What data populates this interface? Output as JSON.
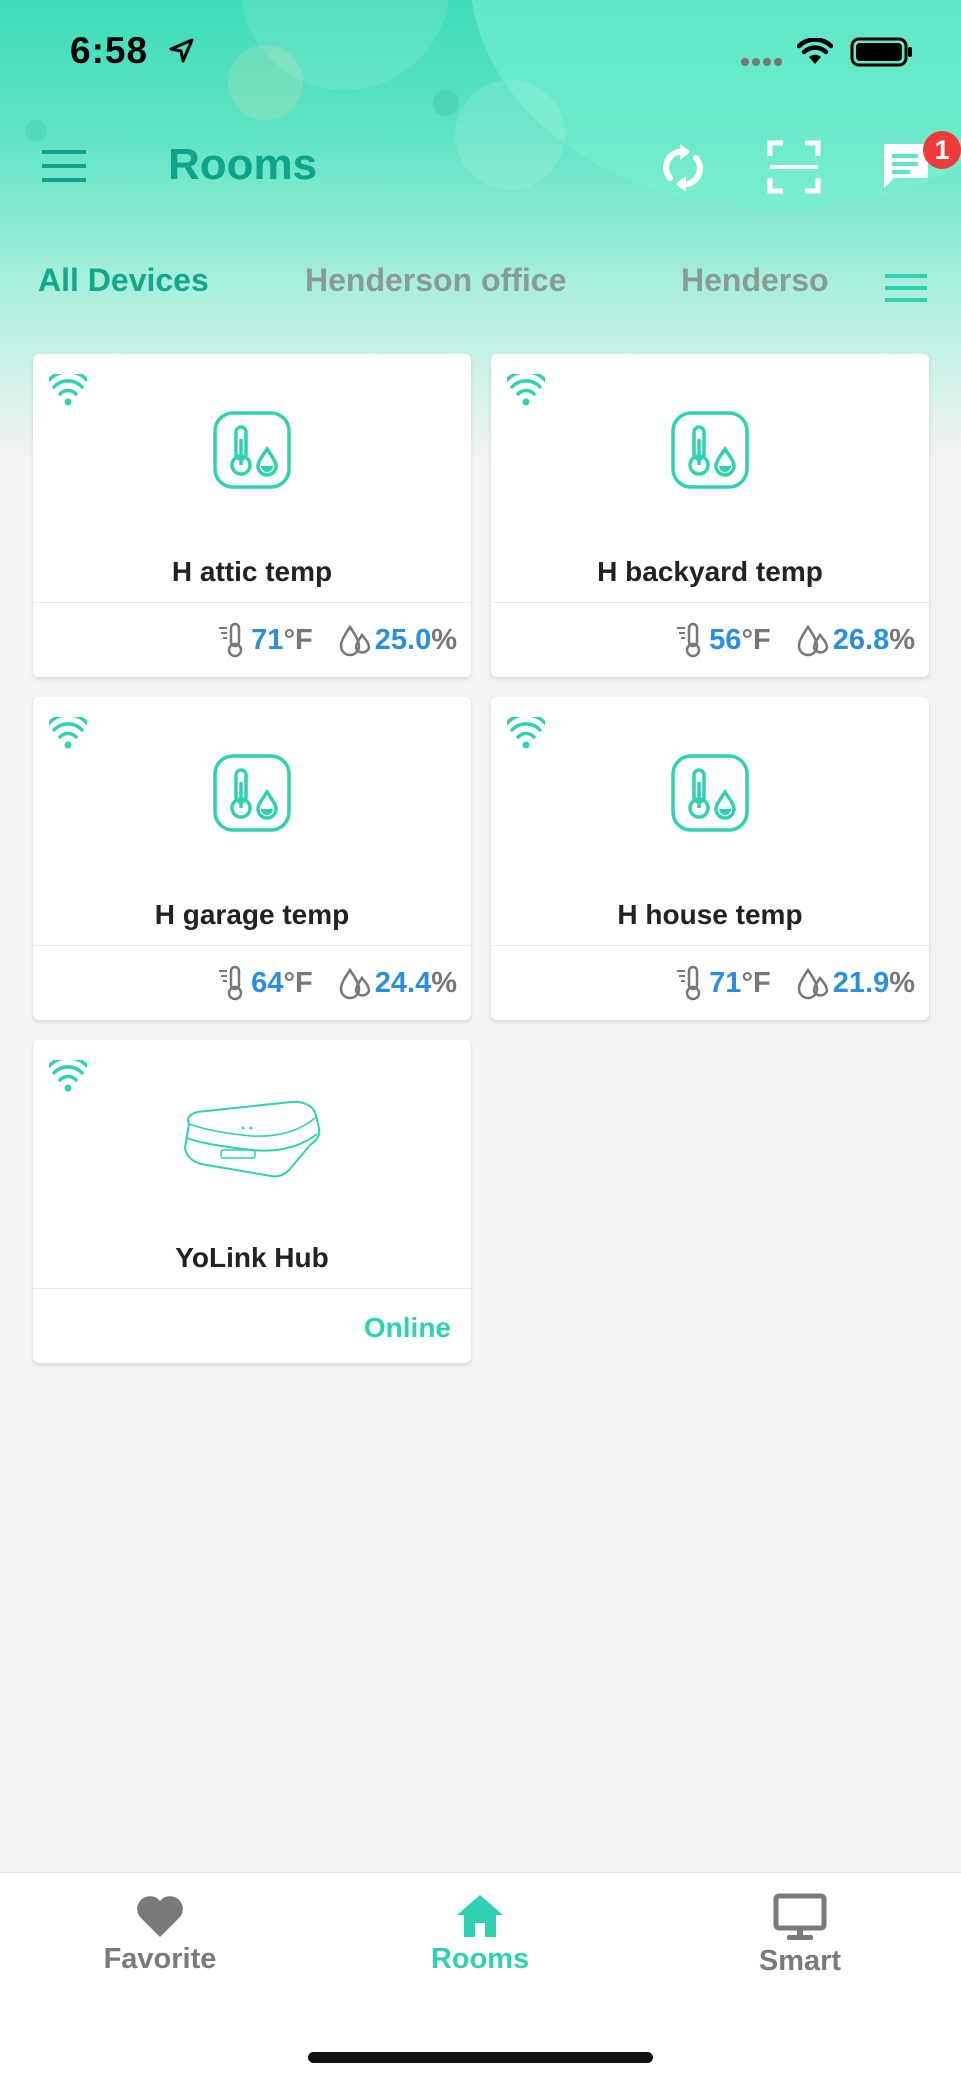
{
  "status_bar": {
    "time": "6:58"
  },
  "header": {
    "title": "Rooms",
    "badge_count": "1"
  },
  "tabs": [
    {
      "label": "All Devices",
      "active": true
    },
    {
      "label": "Henderson office",
      "active": false
    },
    {
      "label": "Henderso",
      "active": false
    }
  ],
  "devices": [
    {
      "name": "H attic temp",
      "temp": "71",
      "temp_unit": "°F",
      "humidity": "25.0",
      "humidity_unit": "%"
    },
    {
      "name": "H backyard temp",
      "temp": "56",
      "temp_unit": "°F",
      "humidity": "26.8",
      "humidity_unit": "%"
    },
    {
      "name": "H garage temp",
      "temp": "64",
      "temp_unit": "°F",
      "humidity": "24.4",
      "humidity_unit": "%"
    },
    {
      "name": "H house temp",
      "temp": "71",
      "temp_unit": "°F",
      "humidity": "21.9",
      "humidity_unit": "%"
    }
  ],
  "hub": {
    "name": "YoLink Hub",
    "status": "Online"
  },
  "bottom_nav": [
    {
      "label": "Favorite",
      "icon": "heart-icon",
      "active": false
    },
    {
      "label": "Rooms",
      "icon": "home-icon",
      "active": true
    },
    {
      "label": "Smart",
      "icon": "monitor-icon",
      "active": false
    }
  ],
  "colors": {
    "accent": "#2fd1b2",
    "title": "#0fa389",
    "value_blue": "#2b8fe0",
    "badge": "#ef3b39"
  }
}
